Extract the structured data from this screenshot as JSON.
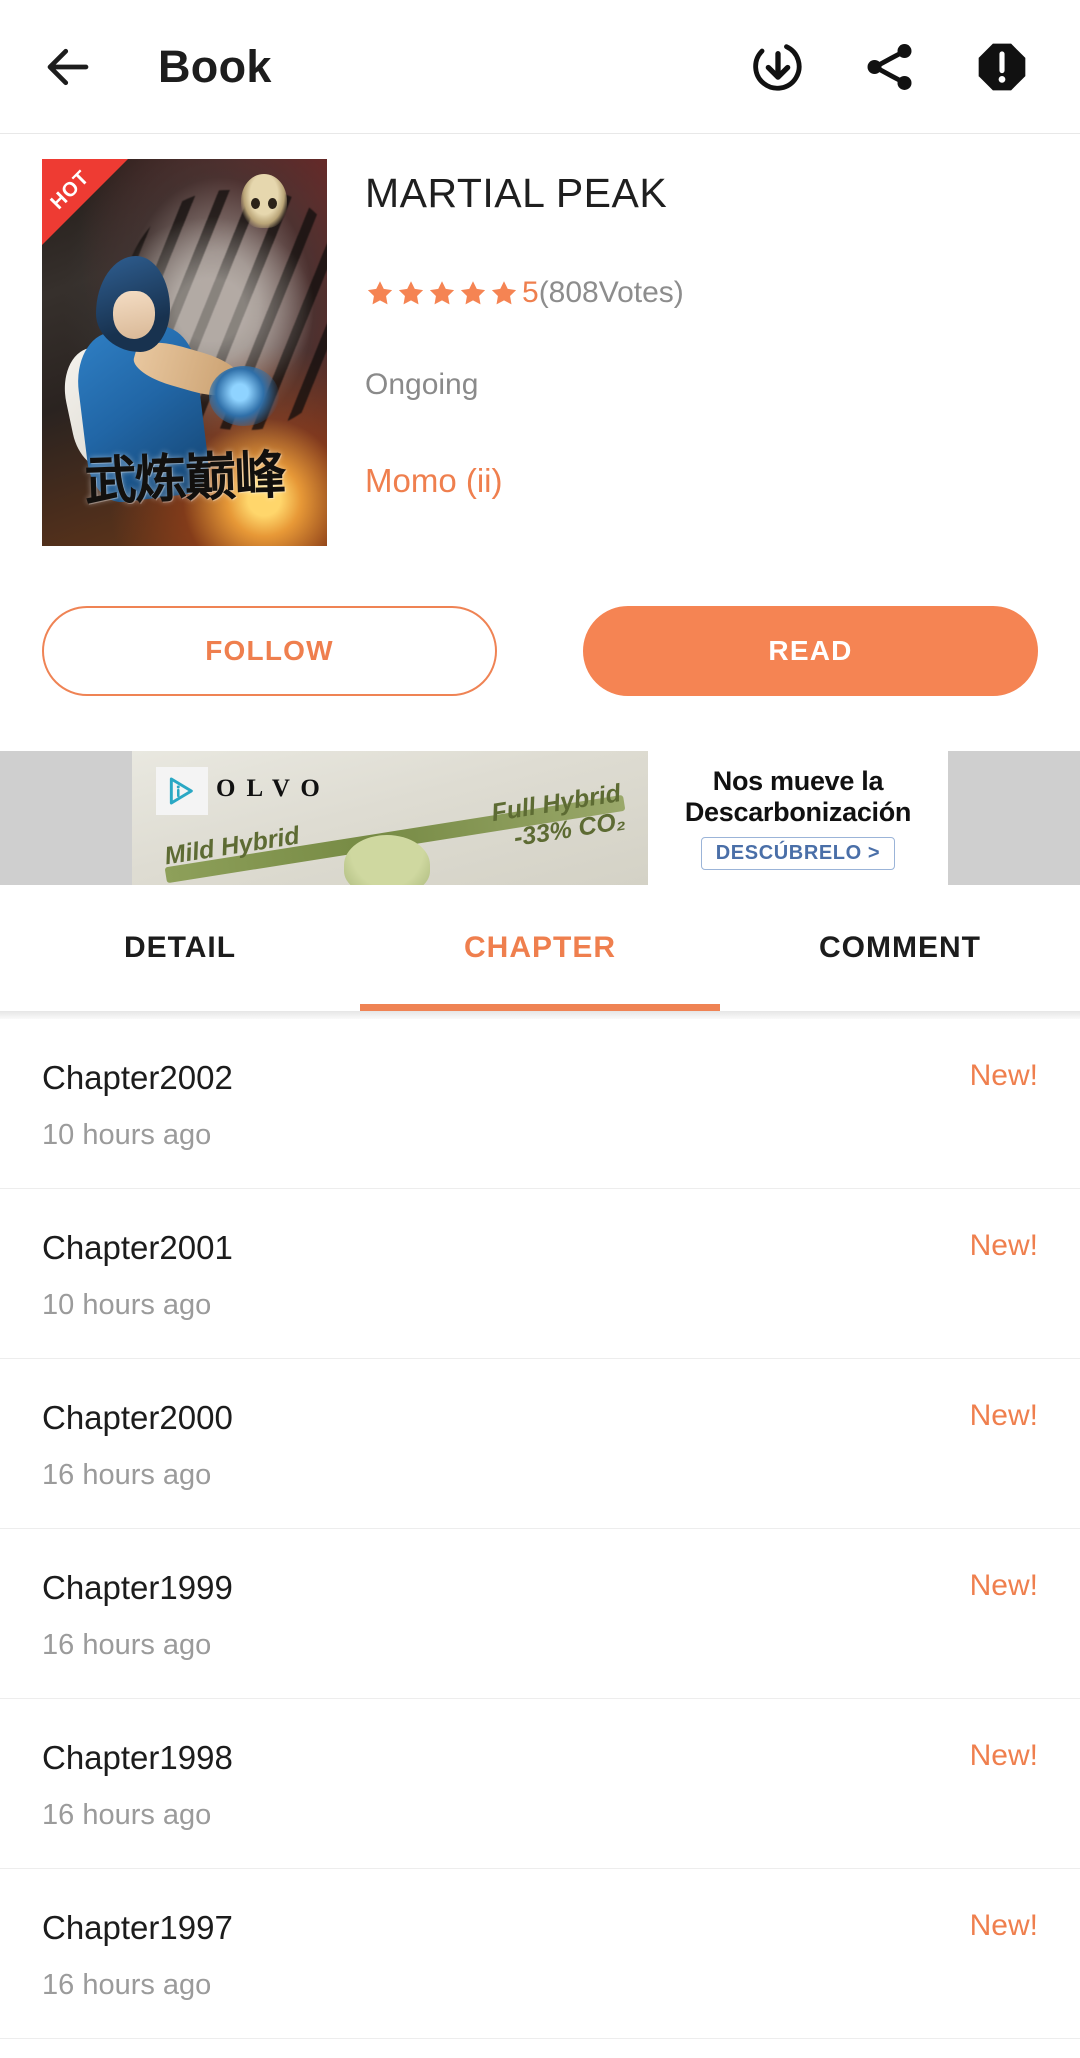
{
  "header": {
    "title": "Book",
    "back_icon": "back-arrow-icon",
    "actions": [
      {
        "name": "download-icon",
        "label": "Download"
      },
      {
        "name": "share-icon",
        "label": "Share"
      },
      {
        "name": "report-icon",
        "label": "Report"
      }
    ]
  },
  "book": {
    "title": "MARTIAL PEAK",
    "badge": "HOT",
    "cover_title_cn": "武炼巅峰",
    "rating": {
      "stars_filled": 5,
      "score": "5",
      "votes": "(808Votes)"
    },
    "status": "Ongoing",
    "author": "Momo (ii)"
  },
  "actions": {
    "follow_label": "FOLLOW",
    "read_label": "READ"
  },
  "ad": {
    "adchoices_icon": "adchoices-icon",
    "brand": "OLVO",
    "label_mild": "Mild Hybrid",
    "label_full_line1": "Full Hybrid",
    "label_full_line2": "-33% CO₂",
    "headline_line1": "Nos mueve la",
    "headline_line2": "Descarbonización",
    "cta": "DESCÚBRELO >"
  },
  "tabs": [
    {
      "label": "DETAIL",
      "active": false
    },
    {
      "label": "CHAPTER",
      "active": true
    },
    {
      "label": "COMMENT",
      "active": false
    }
  ],
  "chapters": [
    {
      "name": "Chapter2002",
      "time": "10 hours ago",
      "badge": "New!"
    },
    {
      "name": "Chapter2001",
      "time": "10 hours ago",
      "badge": "New!"
    },
    {
      "name": "Chapter2000",
      "time": "16 hours ago",
      "badge": "New!"
    },
    {
      "name": "Chapter1999",
      "time": "16 hours ago",
      "badge": "New!"
    },
    {
      "name": "Chapter1998",
      "time": "16 hours ago",
      "badge": "New!"
    },
    {
      "name": "Chapter1997",
      "time": "16 hours ago",
      "badge": "New!"
    }
  ],
  "colors": {
    "accent": "#ef7f4e",
    "accent_fill": "#f58453",
    "badge_red": "#ee3b33",
    "text_primary": "#1c1c1c",
    "text_muted": "#9b9b9b"
  }
}
